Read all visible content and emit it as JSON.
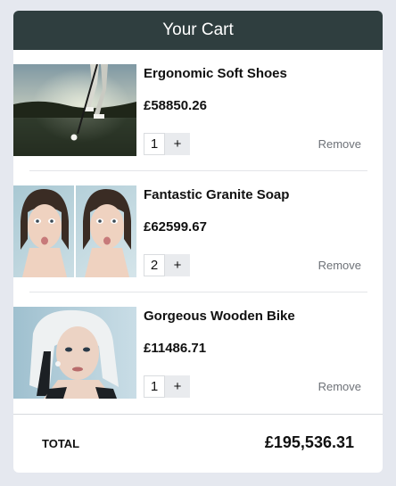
{
  "header": {
    "title": "Your Cart"
  },
  "items": [
    {
      "name": "Ergonomic Soft Shoes",
      "price": "£58850.26",
      "quantity": "1",
      "plus_label": "+",
      "remove_label": "Remove",
      "image": "golfer-putting-photo"
    },
    {
      "name": "Fantastic Granite Soap",
      "price": "£62599.67",
      "quantity": "2",
      "plus_label": "+",
      "remove_label": "Remove",
      "image": "woman-duckface-diptych-photo"
    },
    {
      "name": "Gorgeous Wooden Bike",
      "price": "£11486.71",
      "quantity": "1",
      "plus_label": "+",
      "remove_label": "Remove",
      "image": "platinum-haired-woman-photo"
    }
  ],
  "footer": {
    "total_label": "TOTAL",
    "total_value": "£195,536.31"
  },
  "colors": {
    "header_bg": "#2f3e3f",
    "page_bg": "#e5e8ef",
    "card_bg": "#ffffff"
  }
}
